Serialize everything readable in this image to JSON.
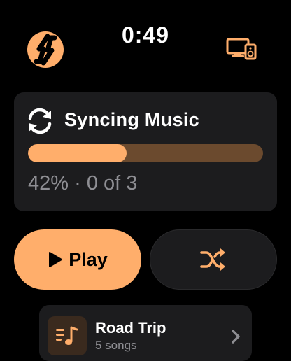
{
  "status_bar": {
    "time": "0:49",
    "app_logo_icon": "app-logo-icon",
    "devices_icon": "devices-icon"
  },
  "sync": {
    "title": "Syncing Music",
    "progress_percent": 42,
    "status_text": "42% · 0 of 3",
    "icon": "sync-icon"
  },
  "controls": {
    "play_label": "Play",
    "play_icon": "play-icon",
    "shuffle_icon": "shuffle-icon"
  },
  "playlists": [
    {
      "name": "Road Trip",
      "count": "5 songs",
      "icon": "music-note-icon"
    }
  ],
  "colors": {
    "accent": "#ffae6b",
    "track": "#6b4a2e",
    "card": "#1c1c1e",
    "background": "#000000",
    "secondary_text": "#8e8e93"
  }
}
